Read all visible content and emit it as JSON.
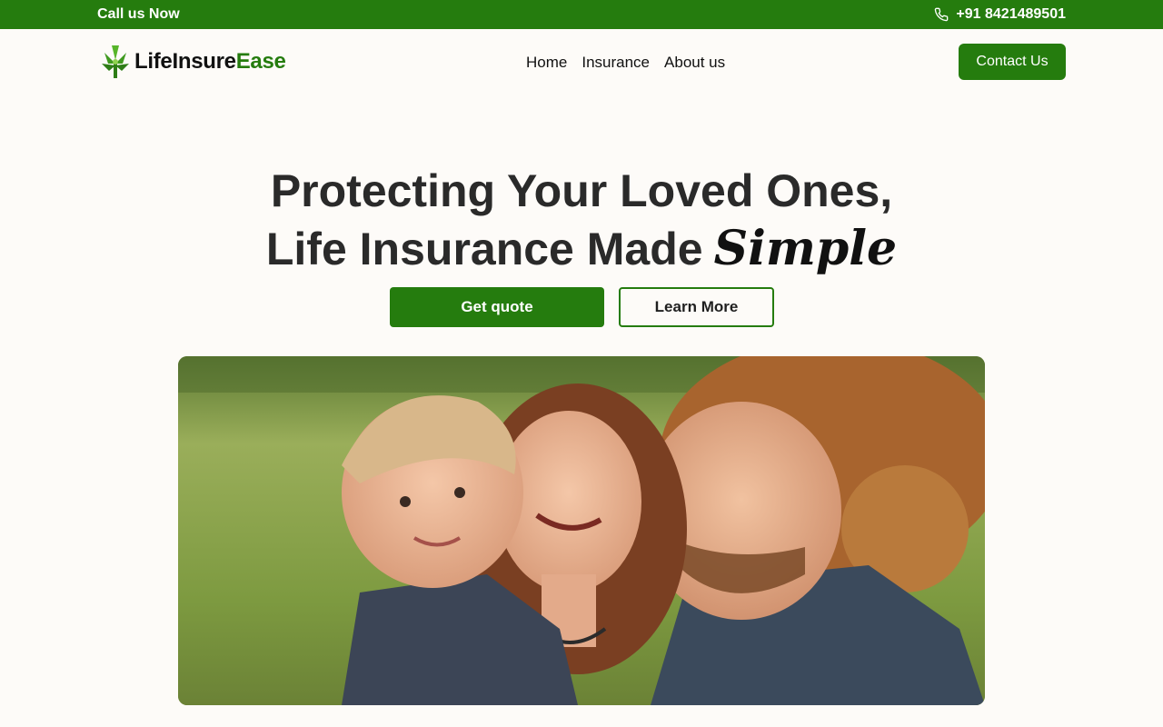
{
  "topbar": {
    "call_label": "Call us Now",
    "phone": "+91 8421489501",
    "phone_icon": "phone-icon"
  },
  "header": {
    "logo_part1": "LifeInsure",
    "logo_part2": "Ease",
    "logo_icon": "tree-icon",
    "nav": [
      "Home",
      "Insurance",
      "About us"
    ],
    "contact_label": "Contact Us"
  },
  "hero": {
    "title_line1": "Protecting Your Loved Ones,",
    "title_line2": "Life Insurance Made",
    "title_script": "Simple",
    "quote_label": "Get quote",
    "learn_label": "Learn More",
    "image_subject": "family-photo"
  },
  "colors": {
    "brand": "#257c0e",
    "background": "#fdfbf8",
    "text": "#2a2a2a"
  }
}
